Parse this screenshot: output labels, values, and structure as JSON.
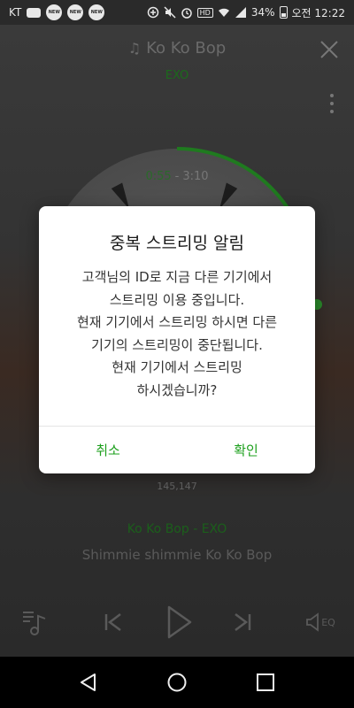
{
  "status_bar": {
    "carrier": "KT",
    "badges": [
      "NEW",
      "NEW",
      "NEW"
    ],
    "battery_percent": "34%",
    "time": "오전 12:22",
    "hd": "HD"
  },
  "player": {
    "song_title": "Ko Ko Bop",
    "artist": "EXO",
    "current_time": "0:55",
    "separator": "-",
    "total_time": "3:10",
    "like_count": "145,147",
    "song_line": "Ko Ko Bop - EXO",
    "lyric": "Shimmie shimmie Ko Ko Bop",
    "eq_label": "EQ"
  },
  "dialog": {
    "title": "중복 스트리밍 알림",
    "body_lines": [
      "고객님의 ID로 지금 다른 기기에서",
      "스트리밍 이용 중입니다.",
      "현재 기기에서 스트리밍 하시면 다른",
      "기기의 스트리밍이 중단됩니다.",
      "현재 기기에서 스트리밍",
      "하시겠습니까?"
    ],
    "cancel_label": "취소",
    "confirm_label": "확인"
  },
  "colors": {
    "accent_green": "#1ea01e",
    "dialog_bg": "#ffffff",
    "navbar_bg": "#000000"
  },
  "icons": [
    "music-note-icon",
    "close-icon",
    "more-vertical-icon",
    "playlist-icon",
    "previous-icon",
    "play-icon",
    "next-icon",
    "eq-icon",
    "back-icon",
    "home-icon",
    "recents-icon"
  ]
}
